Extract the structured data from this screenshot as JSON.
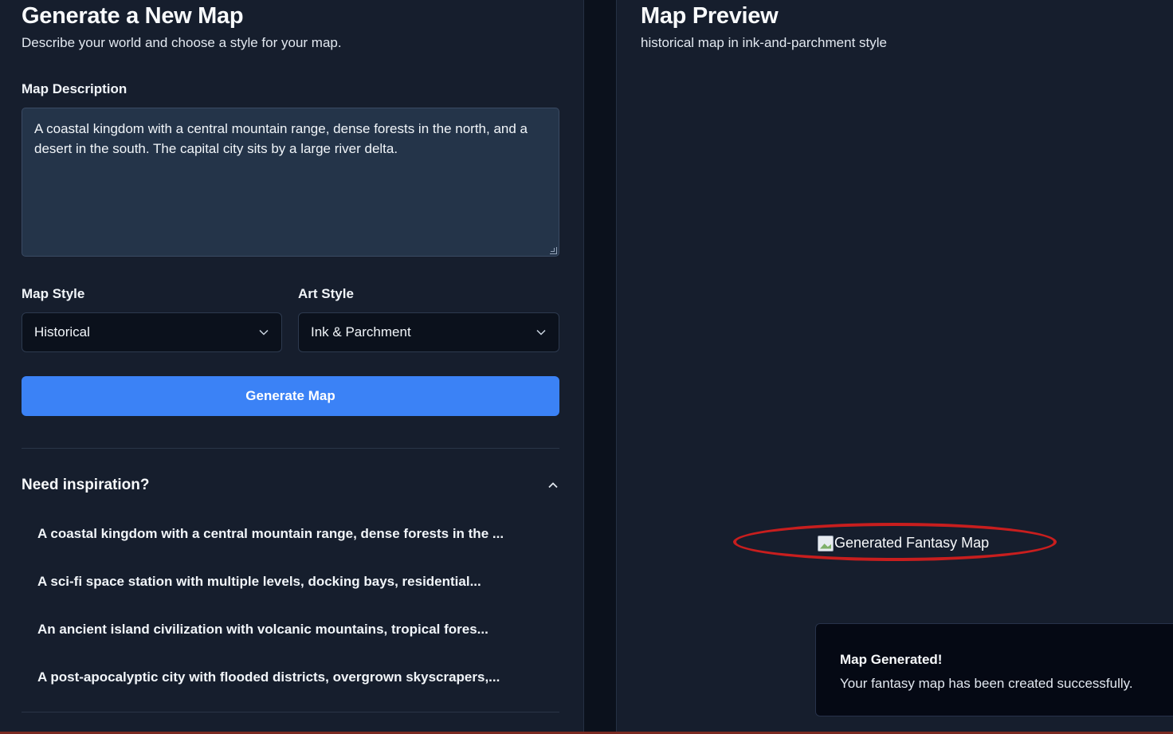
{
  "generator": {
    "title": "Generate a New Map",
    "subtitle": "Describe your world and choose a style for your map.",
    "description_label": "Map Description",
    "description_value": "A coastal kingdom with a central mountain range, dense forests in the north, and a desert in the south. The capital city sits by a large river delta.",
    "map_style_label": "Map Style",
    "map_style_value": "Historical",
    "art_style_label": "Art Style",
    "art_style_value": "Ink & Parchment",
    "generate_label": "Generate Map"
  },
  "inspiration": {
    "title": "Need inspiration?",
    "items": [
      "A coastal kingdom with a central mountain range, dense forests in the ...",
      "A sci-fi space station with multiple levels, docking bays, residential...",
      "An ancient island civilization with volcanic mountains, tropical fores...",
      "A post-apocalyptic city with flooded districts, overgrown skyscrapers,..."
    ]
  },
  "preview": {
    "title": "Map Preview",
    "subtitle": "historical map in ink-and-parchment style",
    "image_alt": "Generated Fantasy Map"
  },
  "toast": {
    "title": "Map Generated!",
    "message": "Your fantasy map has been created successfully."
  },
  "colors": {
    "primary_button": "#3b82f6",
    "panel_bg": "#161e2d",
    "annotation": "#c81e1e"
  }
}
